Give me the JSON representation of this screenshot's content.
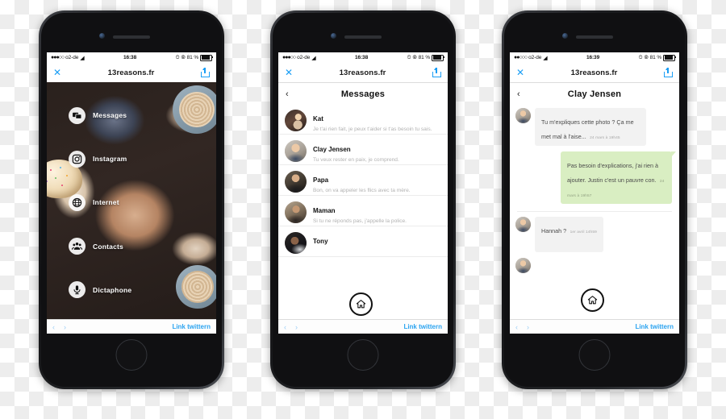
{
  "meta": {
    "site_title": "13reasons.fr",
    "browser_bottom_link": "Link twittern",
    "nav_back_glyph": "‹",
    "nav_forward_glyph": "›",
    "close_glyph": "✕",
    "share_icon": "share-icon",
    "accent_blue": "#1a9ef5",
    "bubble_green": "#d9eec2",
    "bubble_grey": "#f2f2f2"
  },
  "phones": [
    {
      "status_bar": {
        "signal_dots": "●●●○○",
        "carrier": "o2-de",
        "wifi_icon": "wifi-icon",
        "time": "16:38",
        "alarm_icon": "alarm-icon",
        "lock_icon": "rotation-lock-icon",
        "battery_percent": "81 %"
      },
      "screen_type": "photo-menu",
      "menu_items": [
        {
          "label": "Messages",
          "icon": "message-bubble-icon"
        },
        {
          "label": "Instagram",
          "icon": "instagram-icon"
        },
        {
          "label": "Internet",
          "icon": "globe-icon"
        },
        {
          "label": "Contacts",
          "icon": "contacts-group-icon"
        },
        {
          "label": "Dictaphone",
          "icon": "microphone-icon"
        }
      ]
    },
    {
      "status_bar": {
        "signal_dots": "●●●○○",
        "carrier": "o2-de",
        "wifi_icon": "wifi-icon",
        "time": "16:38",
        "alarm_icon": "alarm-icon",
        "lock_icon": "rotation-lock-icon",
        "battery_percent": "81 %"
      },
      "screen_type": "conversation-list",
      "app_header": {
        "title": "Messages",
        "back": "‹"
      },
      "conversations": [
        {
          "name": "Kat",
          "preview": "Je t'ai rien fait, je peux t'aider si t'as besoin tu sais."
        },
        {
          "name": "Clay Jensen",
          "preview": "Tu veux rester en paix, je comprend."
        },
        {
          "name": "Papa",
          "preview": "Bon, on va appeler les flics avec ta mère."
        },
        {
          "name": "Maman",
          "preview": "Si tu ne réponds pas, j'appelle la police."
        },
        {
          "name": "Tony",
          "preview": ""
        }
      ],
      "home_badge": "home-icon"
    },
    {
      "status_bar": {
        "signal_dots": "●●○○○",
        "carrier": "o2-de",
        "wifi_icon": "wifi-icon",
        "time": "16:39",
        "alarm_icon": "alarm-icon",
        "lock_icon": "rotation-lock-icon",
        "battery_percent": "81 %"
      },
      "screen_type": "chat-thread",
      "app_header": {
        "title": "Clay Jensen",
        "back": "‹"
      },
      "messages": [
        {
          "side": "them",
          "text": "Tu m'expliques cette photo ? Ça me met mal à l'aise...",
          "time": "24 mars à 19h45"
        },
        {
          "side": "me",
          "text": "Pas besoin d'explications, j'ai rien à ajouter. Justin c'est un pauvre con.",
          "time": "24 mars à 19h57"
        },
        {
          "side": "them",
          "text": "Hannah ?",
          "time": "1er avril 14h59"
        }
      ],
      "home_badge": "home-icon"
    }
  ]
}
